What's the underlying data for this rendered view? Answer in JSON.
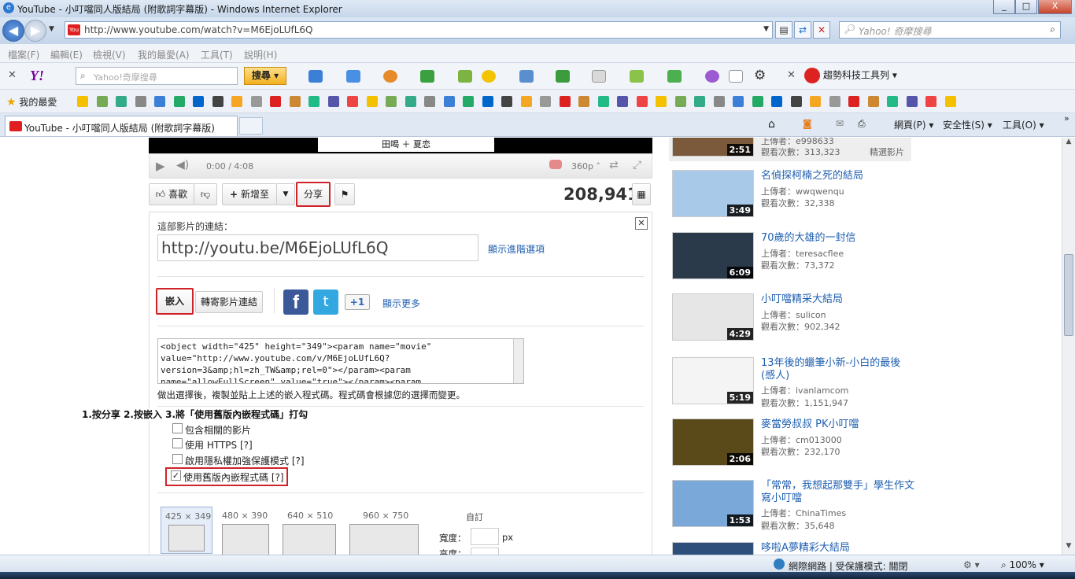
{
  "window": {
    "title": "YouTube - 小叮噹同人版結局 (附歌詞字幕版) - Windows Internet Explorer",
    "controls": [
      "_",
      "□",
      "X"
    ]
  },
  "address": {
    "url": "http://www.youtube.com/watch?v=M6EjoLUfL6Q",
    "search_placeholder": "Yahoo! 奇摩搜尋"
  },
  "menu": [
    "檔案(F)",
    "編輯(E)",
    "檢視(V)",
    "我的最愛(A)",
    "工具(T)",
    "說明(H)"
  ],
  "yahoo_toolbar": {
    "logo": "Y!",
    "search_placeholder": "Yahoo!奇摩搜尋",
    "search_button": "搜尋",
    "trend_label": "趨勢科技工具列"
  },
  "favorites": {
    "label": "我的最愛"
  },
  "tab": {
    "title": "YouTube - 小叮噹同人版結局 (附歌詞字幕版)"
  },
  "command_bar": {
    "page": "網頁(P)",
    "safety": "安全性(S)",
    "tools": "工具(O)"
  },
  "player": {
    "caption": "田喝 ＋ 夏恋",
    "time": "0:00 / 4:08",
    "quality": "360p"
  },
  "actions": {
    "like": "喜歡",
    "add_to": "新增至",
    "share": "分享",
    "view_count": "208,941"
  },
  "share_panel": {
    "link_label": "這部影片的連結：",
    "short_url": "http://youtu.be/M6EjoLUfL6Q",
    "advanced": "顯示進階選項",
    "embed_tab": "嵌入",
    "email_tab": "轉寄影片連結",
    "gplus": "+1",
    "more": "顯示更多",
    "embed_code_lines": [
      "<object width=\"425\" height=\"349\"><param name=\"movie\"",
      "value=\"http://www.youtube.com/v/M6EjoLUfL6Q?",
      "version=3&amp;hl=zh_TW&amp;rel=0\"></param><param",
      "name=\"allowFullScreen\" value=\"true\"></param><param"
    ],
    "embed_hint": "做出選擇後，複製並貼上上述的嵌入程式碼。程式碼會根據您的選擇而變更。",
    "instruction": "1.按分享 2.按嵌入 3.將「使用舊版內嵌程式碼」打勾",
    "options": [
      {
        "label": "包含相關的影片",
        "checked": false
      },
      {
        "label": "使用 HTTPS [?]",
        "checked": false
      },
      {
        "label": "啟用隱私權加強保護模式 [?]",
        "checked": false
      },
      {
        "label": "使用舊版內嵌程式碼 [?]",
        "checked": true
      }
    ],
    "sizes": [
      "425 × 349",
      "480 × 390",
      "640 × 510",
      "960 × 750"
    ],
    "custom": "自訂",
    "width_label": "寬度：",
    "height_label": "高度：",
    "unit": "px"
  },
  "sidebar": [
    {
      "title": "",
      "uploader": "上傳者：e998633",
      "views": "觀看次數：313,323",
      "featured": "精選影片",
      "duration": "2:51"
    },
    {
      "title": "名偵探柯楠之死的結局",
      "uploader": "上傳者：wwqwenqu",
      "views": "觀看次數：32,338",
      "duration": "3:49"
    },
    {
      "title": "70歲的大雄的一封信",
      "uploader": "上傳者：teresacflee",
      "views": "觀看次數：73,372",
      "duration": "6:09"
    },
    {
      "title": "小叮噹精采大結局",
      "uploader": "上傳者：sulicon",
      "views": "觀看次數：902,342",
      "duration": "4:29"
    },
    {
      "title": "13年後的蠟筆小新-小白的最後(感人)",
      "uploader": "上傳者：ivanlamcom",
      "views": "觀看次數：1,151,947",
      "duration": "5:19"
    },
    {
      "title": "麥當勞叔叔 PK小叮噹",
      "uploader": "上傳者：cm013000",
      "views": "觀看次數：232,170",
      "duration": "2:06"
    },
    {
      "title": "「常常，我想起那雙手」學生作文寫小叮噹",
      "uploader": "上傳者：ChinaTimes",
      "views": "觀看次數：35,648",
      "duration": "1:53"
    },
    {
      "title": "哆啦A夢精彩大結局",
      "uploader": "",
      "views": "",
      "duration": ""
    }
  ],
  "status": {
    "zone": "網際網路 | 受保護模式: 關閉",
    "zoom": "100%"
  }
}
